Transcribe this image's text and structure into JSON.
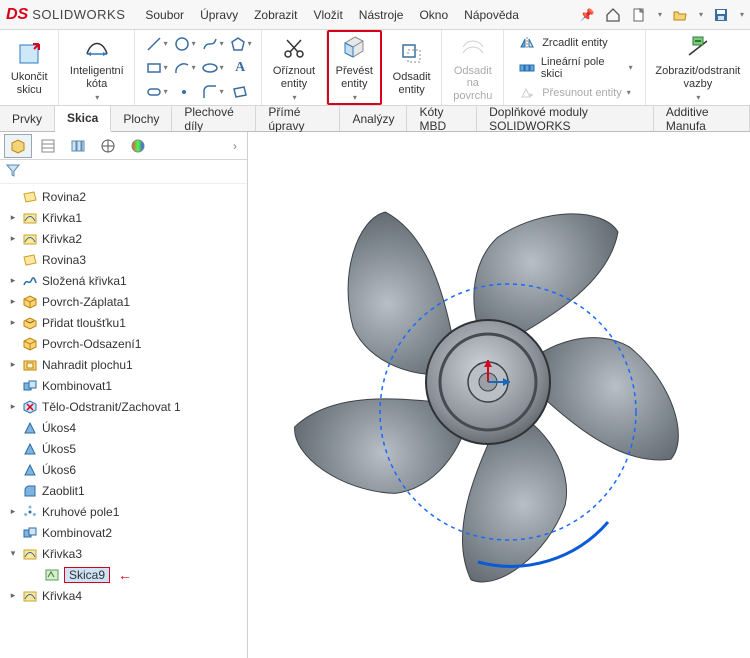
{
  "app": {
    "brand_prefix": "DS",
    "brand": "SOLIDWORKS"
  },
  "menus": [
    "Soubor",
    "Úpravy",
    "Zobrazit",
    "Vložit",
    "Nástroje",
    "Okno",
    "Nápověda"
  ],
  "ribbon": {
    "exitSketch": "Ukončit\nskicu",
    "smartDim": "Inteligentní\nkóta",
    "trim": "Oříznout\nentity",
    "convert": "Převést\nentity",
    "offset": "Odsadit\nentity",
    "offsetSurf": "Odsadit\nna\npovrchu",
    "mirror": "Zrcadlit entity",
    "linPattern": "Lineární pole skici",
    "move": "Přesunout entity",
    "displayRel": "Zobrazit/odstranit\nvazby"
  },
  "tabs": [
    "Prvky",
    "Skica",
    "Plochy",
    "Plechové díly",
    "Přímé úpravy",
    "Analýzy",
    "Kóty MBD",
    "Doplňkové moduly SOLIDWORKS",
    "Additive Manufa"
  ],
  "activeTab": 1,
  "tree": [
    {
      "icon": "plane",
      "label": "Rovina2"
    },
    {
      "icon": "curve",
      "label": "Křivka1",
      "expandable": true
    },
    {
      "icon": "curve",
      "label": "Křivka2",
      "expandable": true
    },
    {
      "icon": "plane",
      "label": "Rovina3"
    },
    {
      "icon": "compcurve",
      "label": "Složená křivka1",
      "expandable": true
    },
    {
      "icon": "surf",
      "label": "Povrch-Záplata1",
      "expandable": true
    },
    {
      "icon": "thicken",
      "label": "Přidat tloušťku1",
      "expandable": true
    },
    {
      "icon": "surf",
      "label": "Povrch-Odsazení1"
    },
    {
      "icon": "replace",
      "label": "Nahradit plochu1",
      "expandable": true
    },
    {
      "icon": "combine",
      "label": "Kombinovat1"
    },
    {
      "icon": "delete",
      "label": "Tělo-Odstranit/Zachovat 1",
      "expandable": true
    },
    {
      "icon": "draft",
      "label": "Úkos4"
    },
    {
      "icon": "draft",
      "label": "Úkos5"
    },
    {
      "icon": "draft",
      "label": "Úkos6"
    },
    {
      "icon": "fillet",
      "label": "Zaoblit1"
    },
    {
      "icon": "cpattern",
      "label": "Kruhové pole1",
      "expandable": true
    },
    {
      "icon": "combine",
      "label": "Kombinovat2"
    },
    {
      "icon": "curve",
      "label": "Křivka3",
      "expandable": true,
      "expanded": true
    },
    {
      "icon": "sketch",
      "label": "Skica9",
      "indent": 1,
      "selected": true,
      "arrow": true
    },
    {
      "icon": "curve",
      "label": "Křivka4",
      "expandable": true
    }
  ]
}
